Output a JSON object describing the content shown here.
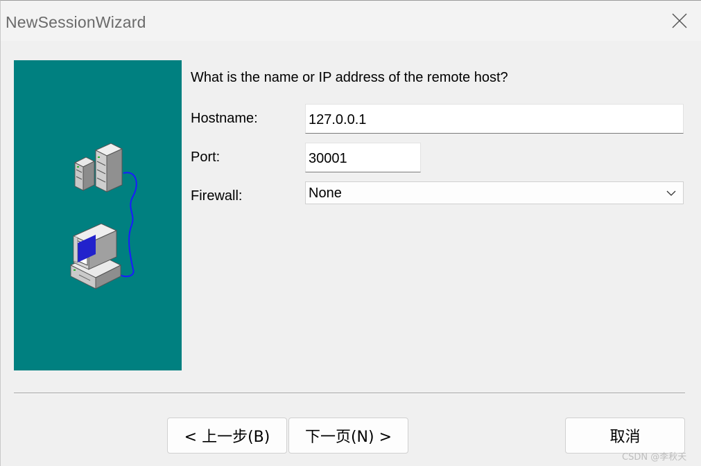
{
  "window": {
    "title": "NewSessionWizard",
    "close_icon": "close-icon"
  },
  "illustration": {
    "background_color": "#008080",
    "icons": [
      "server-icon",
      "computer-icon",
      "network-cable-icon"
    ]
  },
  "form": {
    "question": "What is the name or IP address of the remote host?",
    "hostname_label": "Hostname:",
    "hostname_value": "127.0.0.1",
    "port_label": "Port:",
    "port_value": "30001",
    "firewall_label": "Firewall:",
    "firewall_value": "None"
  },
  "buttons": {
    "back_label": "< 上一步(B)",
    "next_label": "下一页(N) >",
    "cancel_label": "取消"
  },
  "watermark": "CSDN @李秋天"
}
